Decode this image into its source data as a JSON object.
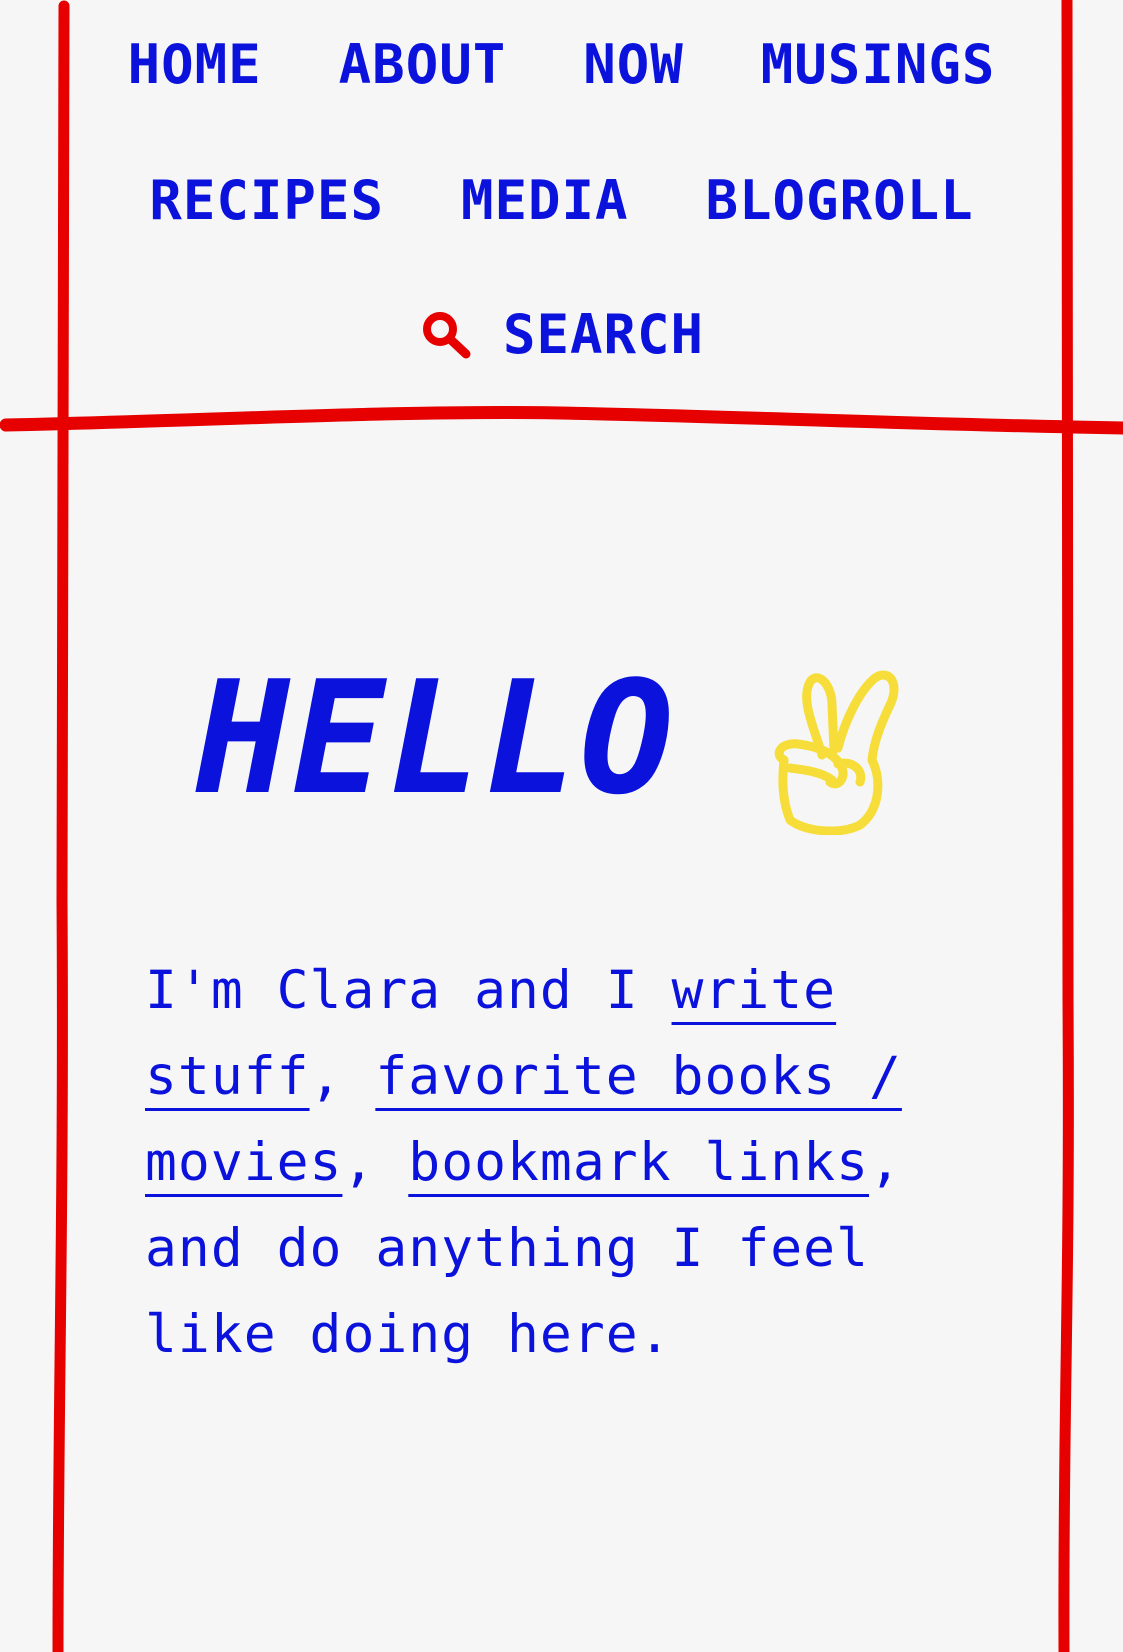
{
  "nav": {
    "row1": [
      {
        "label": "HOME"
      },
      {
        "label": "ABOUT"
      },
      {
        "label": "NOW"
      },
      {
        "label": "MUSINGS"
      }
    ],
    "row2": [
      {
        "label": "RECIPES"
      },
      {
        "label": "MEDIA"
      },
      {
        "label": "BLOGROLL"
      }
    ],
    "search": {
      "label": "SEARCH",
      "icon": "search-icon"
    }
  },
  "hero": {
    "title": "HELLO",
    "icon": "peace-hand-icon"
  },
  "intro": {
    "part1": "I'm Clara and I ",
    "link1": "write stuff",
    "part2": ", ",
    "link2": "favorite books / movies",
    "part3": ", ",
    "link3": "bookmark links",
    "part4": ", and do anything I feel like doing here."
  },
  "colors": {
    "background": "#f6f6f6",
    "text": "#0a12dc",
    "frame": "#e60000",
    "accent_icon": "#f7dd3a"
  }
}
